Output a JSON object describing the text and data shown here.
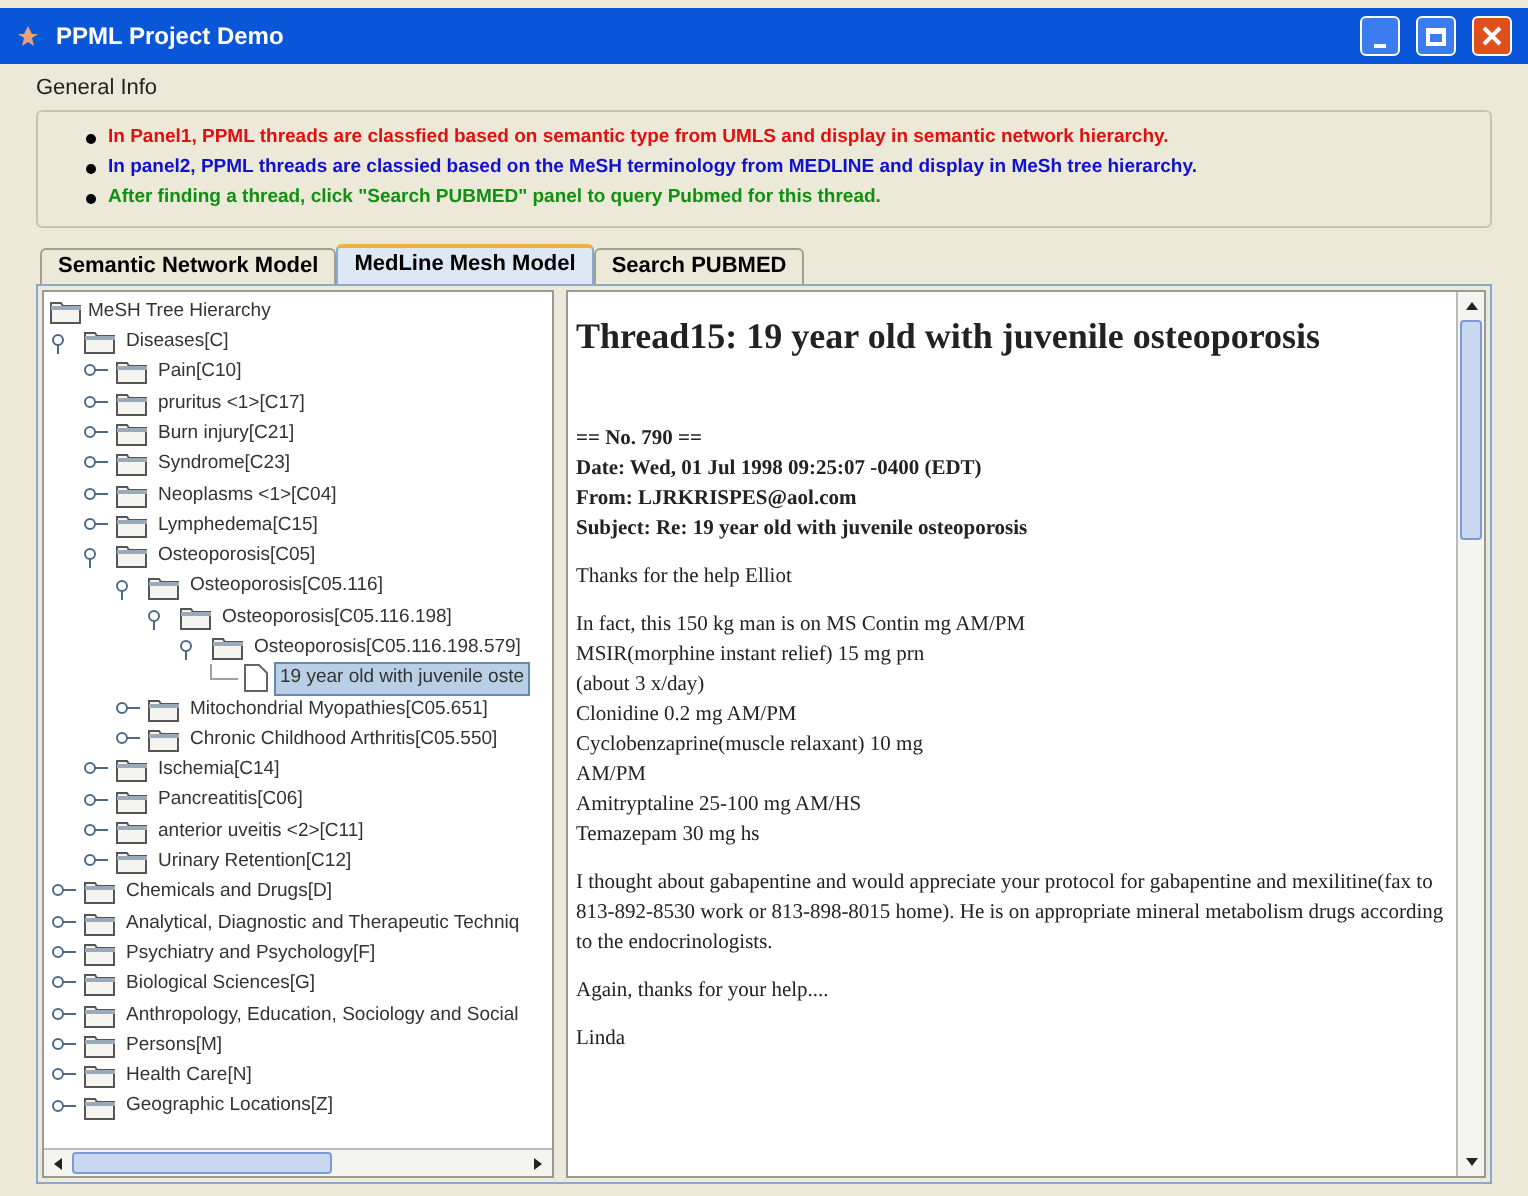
{
  "window": {
    "title": "PPML Project Demo"
  },
  "general_info": {
    "title": "General Info",
    "bullets": [
      {
        "text": "In Panel1, PPML threads are classfied based on semantic type from UMLS and display in semantic network hierarchy.",
        "color": "#e01010"
      },
      {
        "text": "In panel2, PPML threads are classied based on the MeSH terminology from MEDLINE and display in MeSh tree hierarchy.",
        "color": "#1010d0"
      },
      {
        "text": "After finding a thread, click \"Search PUBMED\" panel to query Pubmed for this thread.",
        "color": "#109010"
      }
    ]
  },
  "tabs": [
    {
      "label": "Semantic Network Model",
      "selected": false
    },
    {
      "label": "MedLine Mesh Model",
      "selected": true
    },
    {
      "label": "Search PUBMED",
      "selected": false
    }
  ],
  "tree": {
    "root": "MeSH Tree Hierarchy",
    "items": [
      {
        "label": "Diseases[C]",
        "kind": "folder",
        "expanded": true,
        "selected": false,
        "children": [
          {
            "label": "Pain[C10]",
            "kind": "folder",
            "expanded": false,
            "selected": false
          },
          {
            "label": "pruritus <1>[C17]",
            "kind": "folder",
            "expanded": false,
            "selected": false
          },
          {
            "label": "Burn injury[C21]",
            "kind": "folder",
            "expanded": false,
            "selected": false
          },
          {
            "label": "Syndrome[C23]",
            "kind": "folder",
            "expanded": false,
            "selected": false
          },
          {
            "label": "Neoplasms <1>[C04]",
            "kind": "folder",
            "expanded": false,
            "selected": false
          },
          {
            "label": "Lymphedema[C15]",
            "kind": "folder",
            "expanded": false,
            "selected": false
          },
          {
            "label": "Osteoporosis[C05]",
            "kind": "folder",
            "expanded": true,
            "selected": false,
            "children": [
              {
                "label": "Osteoporosis[C05.116]",
                "kind": "folder",
                "expanded": true,
                "selected": false,
                "children": [
                  {
                    "label": "Osteoporosis[C05.116.198]",
                    "kind": "folder",
                    "expanded": true,
                    "selected": false,
                    "children": [
                      {
                        "label": "Osteoporosis[C05.116.198.579]",
                        "kind": "folder",
                        "expanded": true,
                        "selected": false,
                        "children": [
                          {
                            "label": "19 year old with juvenile oste",
                            "kind": "leaf",
                            "selected": true
                          }
                        ]
                      }
                    ]
                  }
                ]
              },
              {
                "label": "Mitochondrial Myopathies[C05.651]",
                "kind": "folder",
                "expanded": false,
                "selected": false
              },
              {
                "label": "Chronic Childhood Arthritis[C05.550]",
                "kind": "folder",
                "expanded": false,
                "selected": false
              }
            ]
          },
          {
            "label": "Ischemia[C14]",
            "kind": "folder",
            "expanded": false,
            "selected": false
          },
          {
            "label": "Pancreatitis[C06]",
            "kind": "folder",
            "expanded": false,
            "selected": false
          },
          {
            "label": "anterior uveitis <2>[C11]",
            "kind": "folder",
            "expanded": false,
            "selected": false
          },
          {
            "label": "Urinary Retention[C12]",
            "kind": "folder",
            "expanded": false,
            "selected": false
          }
        ]
      },
      {
        "label": "Chemicals and Drugs[D]",
        "kind": "folder",
        "expanded": false,
        "selected": false
      },
      {
        "label": "Analytical, Diagnostic and Therapeutic Techniq",
        "kind": "folder",
        "expanded": false,
        "selected": false
      },
      {
        "label": "Psychiatry and Psychology[F]",
        "kind": "folder",
        "expanded": false,
        "selected": false
      },
      {
        "label": "Biological Sciences[G]",
        "kind": "folder",
        "expanded": false,
        "selected": false
      },
      {
        "label": "Anthropology, Education, Sociology and Social",
        "kind": "folder",
        "expanded": false,
        "selected": false
      },
      {
        "label": "Persons[M]",
        "kind": "folder",
        "expanded": false,
        "selected": false
      },
      {
        "label": "Health Care[N]",
        "kind": "folder",
        "expanded": false,
        "selected": false
      },
      {
        "label": "Geographic Locations[Z]",
        "kind": "folder",
        "expanded": false,
        "selected": false
      }
    ]
  },
  "thread": {
    "title": "Thread15: 19 year old with juvenile osteoporosis",
    "header": [
      "== No. 790 ==",
      "Date: Wed, 01 Jul 1998 09:25:07 -0400 (EDT)",
      "From: LJRKRISPES@aol.com",
      "Subject: Re: 19 year old with juvenile osteoporosis"
    ],
    "paragraphs": [
      [
        "Thanks for the help Elliot"
      ],
      [
        "In fact, this 150 kg man is on MS Contin mg AM/PM",
        "MSIR(morphine instant relief) 15 mg prn",
        "(about 3 x/day)",
        "Clonidine 0.2 mg AM/PM",
        "Cyclobenzaprine(muscle relaxant) 10 mg",
        "AM/PM",
        "Amitryptaline 25-100 mg AM/HS",
        "Temazepam 30 mg hs"
      ],
      [
        "I thought about gabapentine and would appreciate your protocol for gabapentine and mexilitine(fax to 813-892-8530 work or 813-898-8015 home). He is on appropriate mineral metabolism drugs according to the endocrinologists."
      ],
      [
        "Again, thanks for your help...."
      ],
      [
        "Linda"
      ]
    ]
  }
}
